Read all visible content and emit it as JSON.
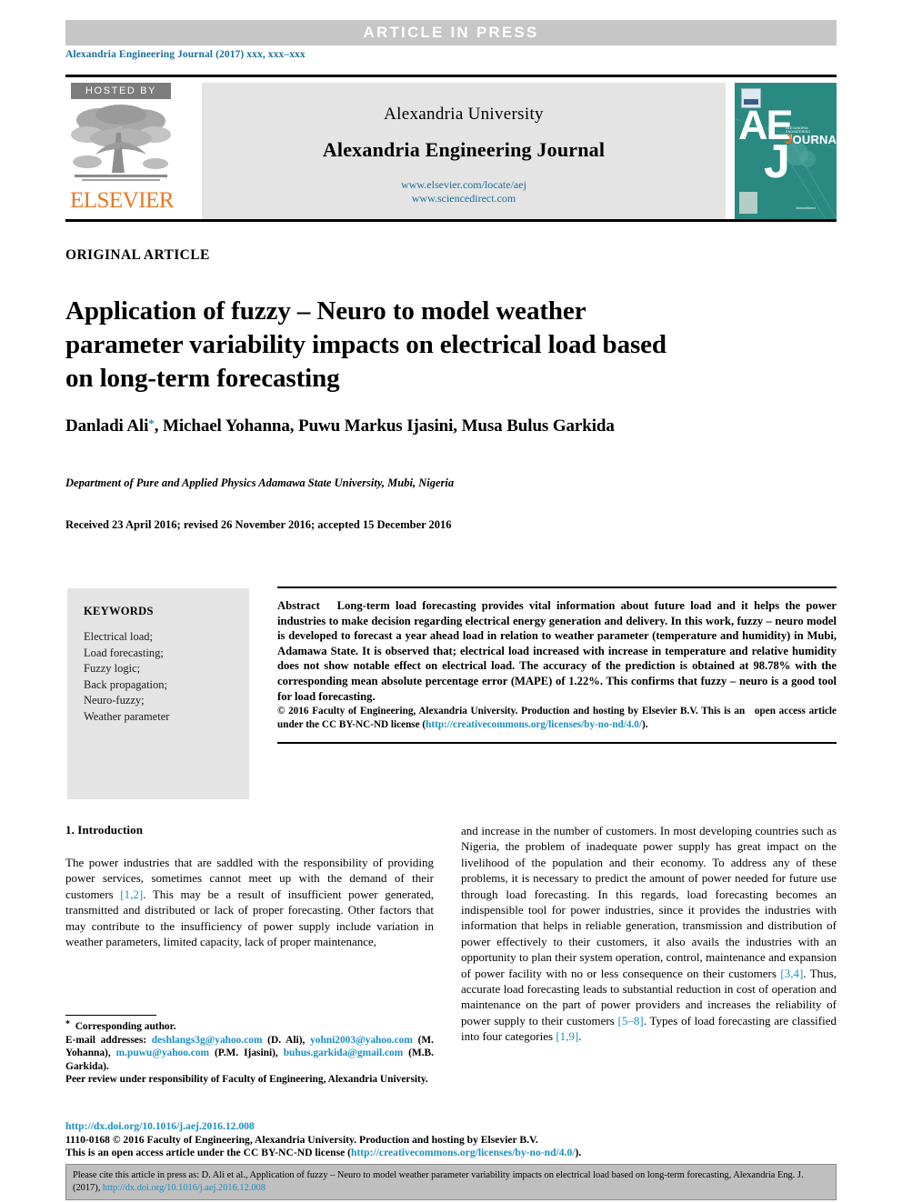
{
  "banner": {
    "label": "ARTICLE  IN  PRESS"
  },
  "running_citation": {
    "text": "Alexandria Engineering Journal (2017) xxx, xxx–xxx"
  },
  "masthead": {
    "hosted_by": "HOSTED BY",
    "publisher": "ELSEVIER",
    "university": "Alexandria University",
    "journal": "Alexandria Engineering Journal",
    "url_elsevier": "www.elsevier.com/locate/aej",
    "url_sciencedirect": "www.sciencedirect.com",
    "cover": {
      "letters_ae": "AE",
      "letter_j": "J",
      "small_title": "ALEXANDRIA ENGINEERING",
      "journal_word_j": "J",
      "journal_word_rest": "OURNAL",
      "bottom_note": "Available online at www.sciencedirect.com",
      "bottom_brand": "ScienceDirect"
    }
  },
  "article": {
    "type_label": "ORIGINAL ARTICLE",
    "title": "Application of fuzzy – Neuro to model weather parameter variability impacts on electrical load based on long-term forecasting",
    "authors_pre": "Danladi Ali",
    "authors_post": ", Michael Yohanna, Puwu Markus Ijasini, Musa Bulus Garkida",
    "affiliation": "Department of Pure and Applied Physics Adamawa State University, Mubi, Nigeria",
    "history": "Received 23 April 2016; revised 26 November 2016; accepted 15 December 2016"
  },
  "keywords": {
    "heading": "KEYWORDS",
    "items": [
      "Electrical load;",
      "Load forecasting;",
      "Fuzzy logic;",
      "Back propagation;",
      "Neuro-fuzzy;",
      "Weather parameter"
    ]
  },
  "abstract": {
    "label": "Abstract",
    "text": "Long-term load forecasting provides vital information about future load and it helps the power industries to make decision regarding electrical energy generation and delivery. In this work, fuzzy – neuro model is developed to forecast a year ahead load in relation to weather parameter (temperature and humidity) in Mubi, Adamawa State. It is observed that; electrical load increased with increase in temperature and relative humidity does not show notable effect on electrical load. The accuracy of the prediction is obtained at 98.78% with the corresponding mean absolute percentage error (MAPE) of 1.22%. This confirms that fuzzy – neuro is a good tool for load forecasting.",
    "copyright_line1": "© 2016 Faculty of Engineering, Alexandria University. Production and hosting by Elsevier B.V. This is an",
    "copyright_line2_pre": "open access article under the CC BY-NC-ND license (",
    "copyright_link": "http://creativecommons.org/licenses/by-no-nd/4.0/",
    "copyright_line2_post": ")."
  },
  "introduction": {
    "heading": "1. Introduction",
    "left_p1_a": "The power industries that are saddled with the responsibility of providing power services, sometimes cannot meet up with the demand of their customers ",
    "left_ref1": "[1,2]",
    "left_p1_b": ". This may be a result of insufficient power generated, transmitted and distributed or lack of proper forecasting. Other factors that may contribute to the insufficiency of power supply include variation in weather parameters, limited capacity, lack of proper maintenance,",
    "right_a": "and increase in the number of customers. In most developing countries such as Nigeria, the problem of inadequate power supply has great impact on the livelihood of the population and their economy. To address any of these problems, it is necessary to predict the amount of power needed for future use through load forecasting. In this regards, load forecasting becomes an indispensible tool for power industries, since it provides the industries with information that helps in reliable generation, transmission and distribution of power effectively to their customers, it also avails the industries with an opportunity to plan their system operation, control, maintenance and expansion of power facility with no or less consequence on their customers ",
    "right_ref1": "[3,4]",
    "right_b": ". Thus, accurate load forecasting leads to substantial reduction in cost of operation and maintenance on the part of power providers and increases the reliability of power supply to their customers ",
    "right_ref2": "[5–8]",
    "right_c": ". Types of load forecasting are classified into four categories ",
    "right_ref3": "[1,9]",
    "right_d": "."
  },
  "footnote": {
    "corresponding": "Corresponding author.",
    "email_label": "E-mail addresses:",
    "emails": [
      {
        "address": "deshlangs3g@yahoo.com",
        "owner": " (D. Ali), "
      },
      {
        "address": "yohni2003@yahoo.com",
        "owner": " (M. Yohanna), "
      },
      {
        "address": "m.puwu@yahoo.com",
        "owner": " (P.M. Ijasini), "
      },
      {
        "address": "buhus.garkida@gmail.com",
        "owner": " (M.B. Garkida)."
      }
    ],
    "peer_review": "Peer review under responsibility of Faculty of Engineering, Alexandria University."
  },
  "bottom": {
    "doi": "http://dx.doi.org/10.1016/j.aej.2016.12.008",
    "issn_line": "1110-0168 © 2016 Faculty of Engineering, Alexandria University. Production and hosting by Elsevier B.V.",
    "license_pre": "This is an open access article under the CC BY-NC-ND license (",
    "license_link": "http://creativecommons.org/licenses/by-no-nd/4.0/",
    "license_post": ")."
  },
  "cite_box": {
    "text_pre": "Please cite this article in press as: D. Ali et al., Application of fuzzy – Neuro to model weather parameter variability impacts on electrical load based on long-term forecasting,  Alexandria Eng. J. (2017), ",
    "link": "http://dx.doi.org/10.1016/j.aej.2016.12.008"
  },
  "colors": {
    "banner_bg": "#c6c6c6",
    "link_blue": "#1a8fc1",
    "header_blue": "#1a6f9c",
    "elsevier_orange": "#e87722",
    "cover_teal": "#2a8a82",
    "panel_gray": "#e4e4e4",
    "cite_gray": "#bfbfbf"
  }
}
